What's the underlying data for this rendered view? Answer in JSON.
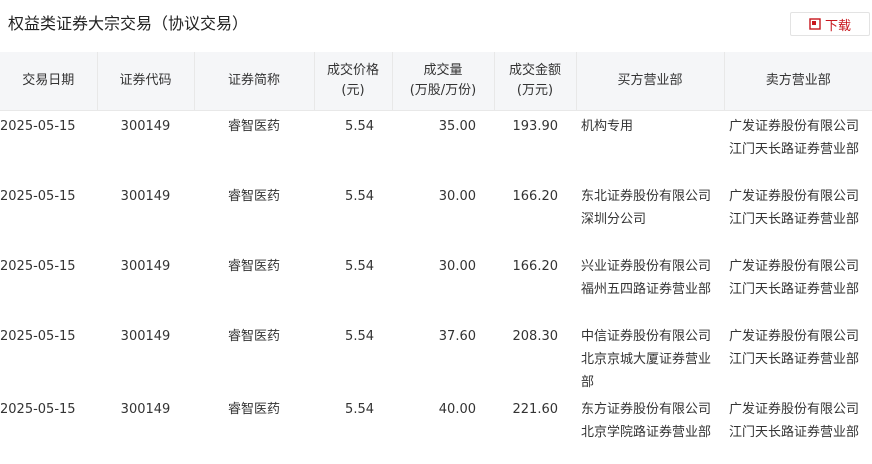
{
  "header": {
    "title": "权益类证券大宗交易（协议交易）",
    "download_label": "下载"
  },
  "table": {
    "columns": [
      {
        "line1": "交易日期",
        "line2": ""
      },
      {
        "line1": "证券代码",
        "line2": ""
      },
      {
        "line1": "证券简称",
        "line2": ""
      },
      {
        "line1": "成交价格",
        "line2": "(元)"
      },
      {
        "line1": "成交量",
        "line2": "(万股/万份)"
      },
      {
        "line1": "成交金额",
        "line2": "(万元)"
      },
      {
        "line1": "买方营业部",
        "line2": ""
      },
      {
        "line1": "卖方营业部",
        "line2": ""
      }
    ],
    "rows": [
      {
        "date": "2025-05-15",
        "code": "300149",
        "name": "睿智医药",
        "price": "5.54",
        "volume": "35.00",
        "amount": "193.90",
        "buyer": "机构专用",
        "seller": "广发证券股份有限公司江门天长路证券营业部"
      },
      {
        "date": "2025-05-15",
        "code": "300149",
        "name": "睿智医药",
        "price": "5.54",
        "volume": "30.00",
        "amount": "166.20",
        "buyer": "东北证券股份有限公司深圳分公司",
        "seller": "广发证券股份有限公司江门天长路证券营业部"
      },
      {
        "date": "2025-05-15",
        "code": "300149",
        "name": "睿智医药",
        "price": "5.54",
        "volume": "30.00",
        "amount": "166.20",
        "buyer": "兴业证券股份有限公司福州五四路证券营业部",
        "seller": "广发证券股份有限公司江门天长路证券营业部"
      },
      {
        "date": "2025-05-15",
        "code": "300149",
        "name": "睿智医药",
        "price": "5.54",
        "volume": "37.60",
        "amount": "208.30",
        "buyer": "中信证券股份有限公司北京京城大厦证券营业部",
        "seller": "广发证券股份有限公司江门天长路证券营业部"
      },
      {
        "date": "2025-05-15",
        "code": "300149",
        "name": "睿智医药",
        "price": "5.54",
        "volume": "40.00",
        "amount": "221.60",
        "buyer": "东方证券股份有限公司北京学院路证券营业部",
        "seller": "广发证券股份有限公司江门天长路证券营业部"
      }
    ]
  },
  "colors": {
    "accent": "#c8161d",
    "header_bg": "#f5f6f8"
  },
  "icons": {
    "download": "pdf-download-icon"
  }
}
